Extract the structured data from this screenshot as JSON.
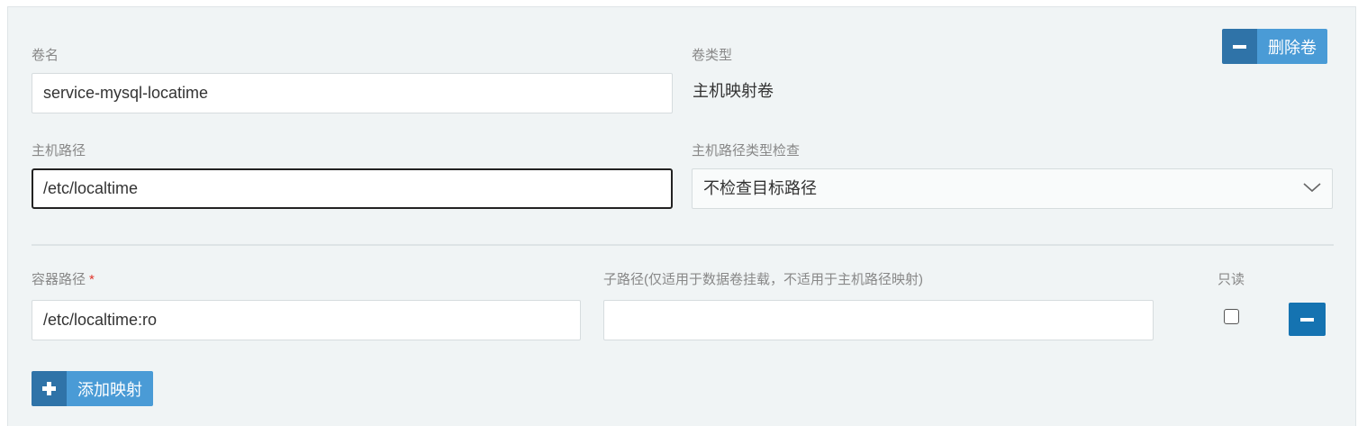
{
  "volume": {
    "name_label": "卷名",
    "name_value": "service-mysql-locatime",
    "type_label": "卷类型",
    "type_value": "主机映射卷",
    "delete_label": "删除卷"
  },
  "host": {
    "path_label": "主机路径",
    "path_value": "/etc/localtime",
    "check_label": "主机路径类型检查",
    "check_value": "不检查目标路径"
  },
  "mount": {
    "container_path_label": "容器路径",
    "required_mark": "*",
    "container_path_value": "/etc/localtime:ro",
    "subpath_label": "子路径(仅适用于数据卷挂载，不适用于主机路径映射)",
    "subpath_value": "",
    "readonly_label": "只读",
    "readonly_checked": false
  },
  "actions": {
    "add_mapping_label": "添加映射"
  },
  "colors": {
    "button_dark": "#2f73a8",
    "button_light": "#4a9bd6",
    "remove_button": "#1573b1",
    "required": "#e0352b"
  }
}
